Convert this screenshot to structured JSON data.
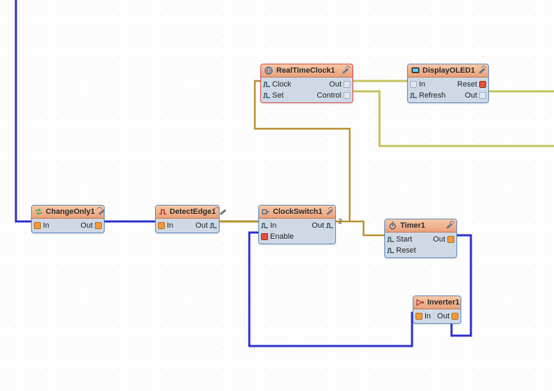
{
  "nodes": {
    "change": {
      "title": "ChangeOnly1",
      "pins": {
        "in": "In",
        "out": "Out"
      }
    },
    "detect": {
      "title": "DetectEdge1",
      "pins": {
        "in": "In",
        "out": "Out"
      }
    },
    "clockswitch": {
      "title": "ClockSwitch1",
      "pins": {
        "in": "In",
        "out": "Out",
        "enable": "Enable"
      },
      "out_badge": "2"
    },
    "rtc": {
      "title": "RealTimeClock1",
      "pins": {
        "clock": "Clock",
        "set": "Set",
        "out": "Out",
        "control": "Control"
      }
    },
    "oled": {
      "title": "DisplayOLED1",
      "pins": {
        "in": "In",
        "refresh": "Refresh",
        "reset": "Reset",
        "out": "Out"
      }
    },
    "timer": {
      "title": "Timer1",
      "pins": {
        "start": "Start",
        "reset": "Reset",
        "out": "Out"
      }
    },
    "inverter": {
      "title": "Inverter1",
      "pins": {
        "in": "In",
        "out": "Out"
      }
    }
  },
  "icon_names": {
    "change": "swap-icon",
    "detect": "edge-icon",
    "clockswitch": "gate-icon",
    "rtc": "globe-icon",
    "oled": "display-icon",
    "timer": "timer-icon",
    "inverter": "not-icon"
  },
  "colors": {
    "wire_blue": "#2d2dcf",
    "wire_ochre": "#b88f2e",
    "wire_olive": "#c4c25a"
  }
}
